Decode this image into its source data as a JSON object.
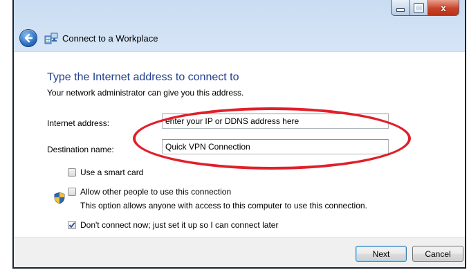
{
  "window": {
    "title": "Connect to a Workplace",
    "controls": [
      "minimize",
      "maximize",
      "close"
    ],
    "close_glyph": "x"
  },
  "page": {
    "heading": "Type the Internet address to connect to",
    "subtext": "Your network administrator can give you this address."
  },
  "form": {
    "internet_address_label": "Internet address:",
    "internet_address_value": "enter your IP or DDNS address here",
    "destination_name_label": "Destination name:",
    "destination_name_value": "Quick VPN Connection"
  },
  "options": {
    "smart_card": {
      "label": "Use a smart card",
      "checked": false
    },
    "allow_others": {
      "label": "Allow other people to use this connection",
      "description": "This option allows anyone with access to this computer to use this connection.",
      "checked": false,
      "icon": "uac-shield-icon"
    },
    "connect_later": {
      "label": "Don't connect now; just set it up so I can connect later",
      "checked": true
    }
  },
  "buttons": {
    "next": "Next",
    "cancel": "Cancel"
  },
  "annotation": {
    "shape": "ellipse",
    "color": "#e0202a"
  },
  "colors": {
    "heading": "#1e3e8c",
    "chrome": "#cfe0f3",
    "close_button": "#c7432a"
  }
}
